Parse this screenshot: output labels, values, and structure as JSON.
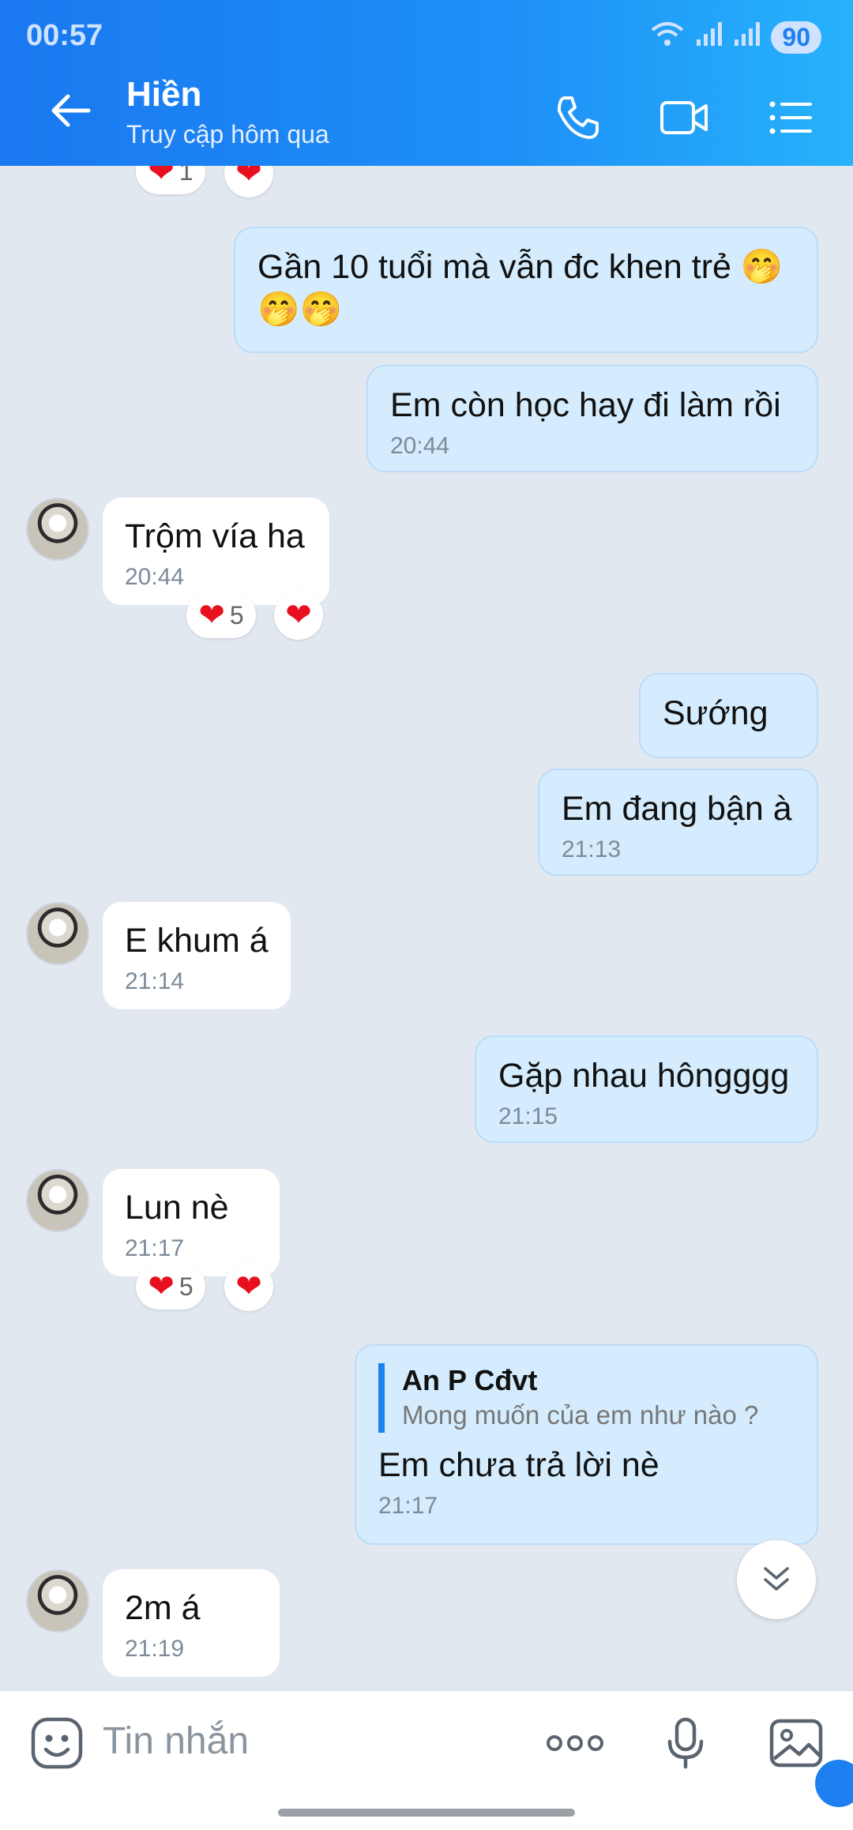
{
  "status_bar": {
    "time": "00:57",
    "battery": "90"
  },
  "header": {
    "title": "Hiền",
    "subtitle": "Truy cập hôm qua"
  },
  "messages": {
    "m1": {
      "text": "Gần 10 tuổi mà vẫn đc khen trẻ 🤭🤭🤭"
    },
    "m2": {
      "text": "Em còn học hay đi làm rồi",
      "time": "20:44"
    },
    "m3": {
      "text": "Trộm vía ha",
      "time": "20:44",
      "reaction_count": "5"
    },
    "m4": {
      "text": "Sướng"
    },
    "m5": {
      "text": "Em đang bận à",
      "time": "21:13"
    },
    "m6": {
      "text": "E khum á",
      "time": "21:14"
    },
    "m7": {
      "text": "Gặp nhau hôngggg",
      "time": "21:15"
    },
    "m8": {
      "text": "Lun nè",
      "time": "21:17",
      "reaction_count": "5"
    },
    "m9": {
      "reply_name": "An P Cđvt",
      "reply_text": "Mong muốn của em như nào ?",
      "text": "Em chưa trả lời nè",
      "time": "21:17"
    },
    "m10": {
      "text": "2m á",
      "time": "21:19"
    }
  },
  "top_reaction": {
    "count": "1"
  },
  "input": {
    "placeholder": "Tin nhắn"
  },
  "colors": {
    "header_start": "#1a78f0",
    "header_end": "#27b2fb",
    "outgoing_bubble": "#d4ecfd",
    "incoming_bubble": "#ffffff",
    "heart": "#e8101e"
  }
}
